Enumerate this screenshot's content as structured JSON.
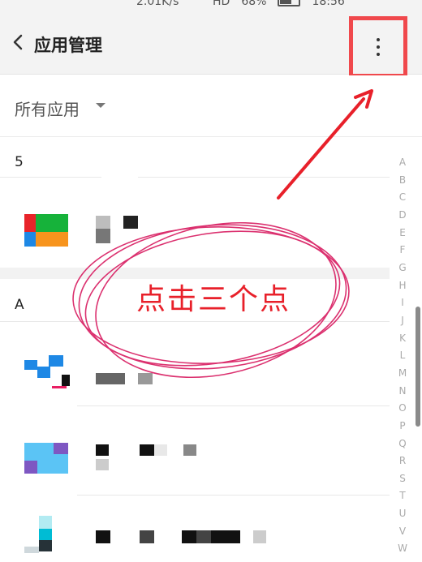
{
  "status_bar": {
    "left": "",
    "speed": "2.01K/s",
    "hd": "HD",
    "battery": "68%",
    "time": "18:56"
  },
  "app_bar": {
    "title": "应用管理",
    "back_icon": "chevron-left-icon",
    "more_icon": "more-vertical-icon"
  },
  "filter": {
    "label": "所有应用",
    "caret_icon": "caret-down-icon"
  },
  "sections": [
    {
      "letter": "5"
    },
    {
      "letter": "A"
    }
  ],
  "alphabet_index": [
    "A",
    "B",
    "C",
    "D",
    "E",
    "F",
    "G",
    "H",
    "I",
    "J",
    "K",
    "L",
    "M",
    "N",
    "O",
    "P",
    "Q",
    "R",
    "S",
    "T",
    "U",
    "V",
    "W"
  ],
  "annotation": {
    "text": "点击三个点",
    "color": "#e8202a",
    "highlight_color": "#f0484c"
  },
  "colors": {
    "app_bar_bg": "#f3f3f3",
    "annotation_red": "#e8202a"
  }
}
